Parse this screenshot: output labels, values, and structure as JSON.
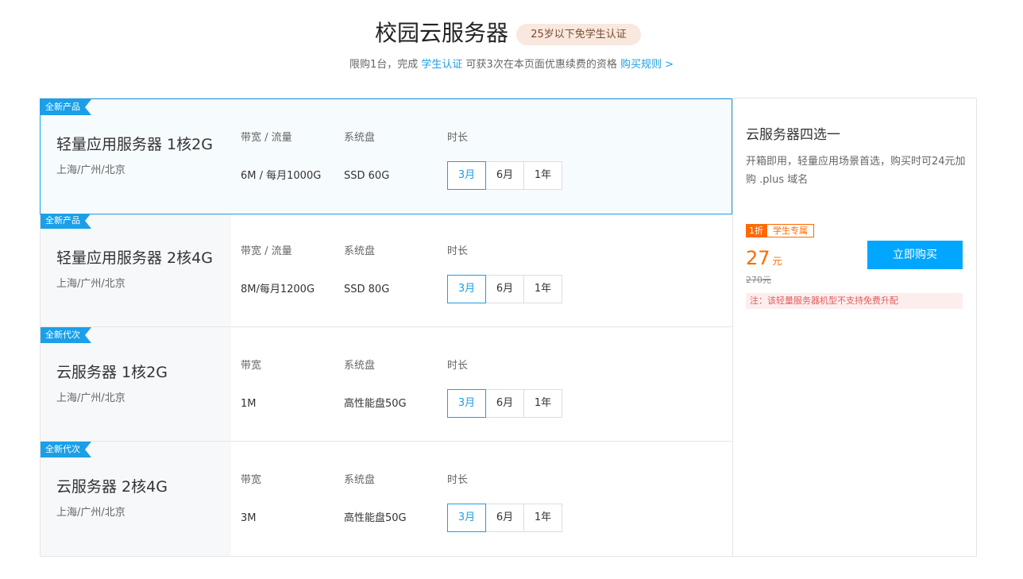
{
  "header": {
    "title": "校园云服务器",
    "badge": "25岁以下免学生认证",
    "sub_prefix": "限购1台，完成 ",
    "sub_link1": "学生认证",
    "sub_middle": " 可获3次在本页面优惠续费的资格 ",
    "sub_link2": "购买规则 >"
  },
  "labels": {
    "bandwidth_traffic": "带宽 / 流量",
    "bandwidth": "带宽",
    "disk": "系统盘",
    "duration": "时长"
  },
  "products": [
    {
      "tag": "全新产品",
      "name": "轻量应用服务器 1核2G",
      "region": "上海/广州/北京",
      "col1_label": "带宽 / 流量",
      "col1_value": "6M / 每月1000G",
      "col2_label": "系统盘",
      "col2_value": "SSD 60G",
      "col3_label": "时长",
      "durations": [
        "3月",
        "6月",
        "1年"
      ],
      "selected_duration": "3月",
      "selected": true
    },
    {
      "tag": "全新产品",
      "name": "轻量应用服务器 2核4G",
      "region": "上海/广州/北京",
      "col1_label": "带宽 / 流量",
      "col1_value": "8M/每月1200G",
      "col2_label": "系统盘",
      "col2_value": "SSD 80G",
      "col3_label": "时长",
      "durations": [
        "3月",
        "6月",
        "1年"
      ],
      "selected_duration": "3月",
      "selected": false
    },
    {
      "tag": "全新代次",
      "name": "云服务器 1核2G",
      "region": "上海/广州/北京",
      "col1_label": "带宽",
      "col1_value": "1M",
      "col2_label": "系统盘",
      "col2_value": "高性能盘50G",
      "col3_label": "时长",
      "durations": [
        "3月",
        "6月",
        "1年"
      ],
      "selected_duration": "3月",
      "selected": false
    },
    {
      "tag": "全新代次",
      "name": "云服务器 2核4G",
      "region": "上海/广州/北京",
      "col1_label": "带宽",
      "col1_value": "3M",
      "col2_label": "系统盘",
      "col2_value": "高性能盘50G",
      "col3_label": "时长",
      "durations": [
        "3月",
        "6月",
        "1年"
      ],
      "selected_duration": "3月",
      "selected": false
    }
  ],
  "side": {
    "title": "云服务器四选一",
    "desc": "开箱即用，轻量应用场景首选，购买时可24元加购 .plus 域名",
    "discount_badge": "1折",
    "student_badge": "学生专属",
    "price": "27",
    "price_unit": "元",
    "original_price": "270元",
    "buy_label": "立即购买",
    "note": "注：该轻量服务器机型不支持免费升配"
  },
  "colors": {
    "accent": "#1a9fe8",
    "buy_button": "#00a6ff",
    "price": "#ff6a00",
    "note_bg": "#fdeeee",
    "note_text": "#e55a5a"
  }
}
